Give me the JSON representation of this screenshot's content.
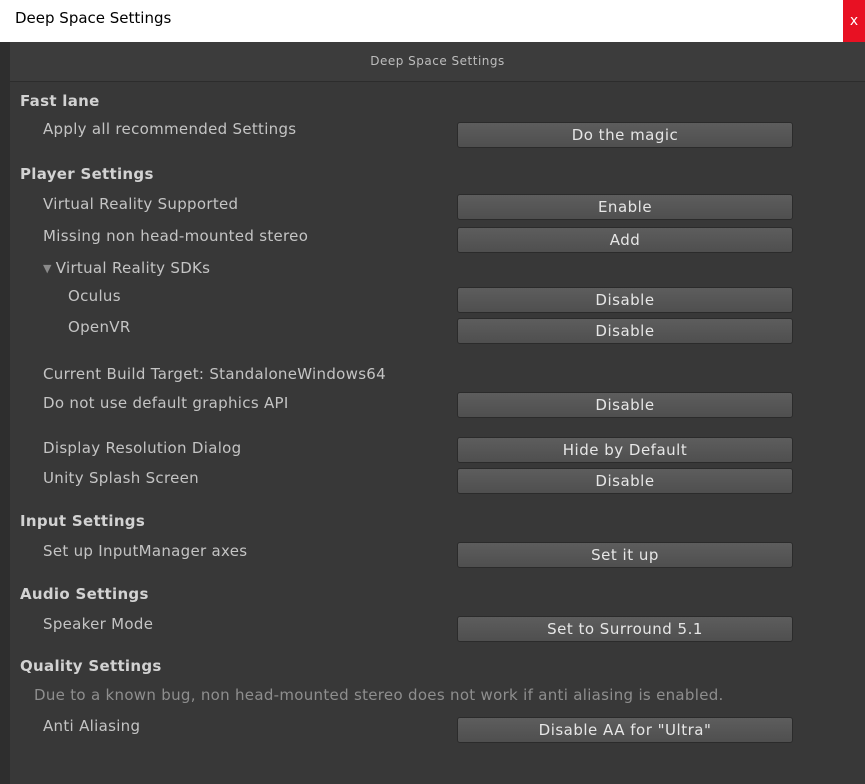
{
  "window": {
    "title": "Deep Space Settings",
    "close_glyph": "x"
  },
  "header": {
    "label": "Deep Space Settings"
  },
  "fast_lane": {
    "heading": "Fast lane",
    "apply_label": "Apply all recommended Settings",
    "apply_button": "Do the magic"
  },
  "player_settings": {
    "heading": "Player Settings",
    "vr_supported_label": "Virtual Reality Supported",
    "vr_supported_button": "Enable",
    "missing_stereo_label": "Missing non head-mounted stereo",
    "missing_stereo_button": "Add",
    "vr_sdks_label": "Virtual Reality SDKs",
    "oculus_label": "Oculus",
    "oculus_button": "Disable",
    "openvr_label": "OpenVR",
    "openvr_button": "Disable",
    "build_target_label": "Current Build Target: StandaloneWindows64",
    "graphics_api_label": "Do not use default graphics API",
    "graphics_api_button": "Disable",
    "resolution_dialog_label": "Display Resolution Dialog",
    "resolution_dialog_button": "Hide by Default",
    "splash_label": "Unity Splash Screen",
    "splash_button": "Disable"
  },
  "input_settings": {
    "heading": "Input Settings",
    "axes_label": "Set up InputManager axes",
    "axes_button": "Set it up"
  },
  "audio_settings": {
    "heading": "Audio Settings",
    "speaker_label": "Speaker Mode",
    "speaker_button": "Set to Surround 5.1"
  },
  "quality_settings": {
    "heading": "Quality Settings",
    "note": "Due to a known bug, non head-mounted stereo does not work if anti aliasing is enabled.",
    "aa_label": "Anti Aliasing",
    "aa_button": "Disable AA for \"Ultra\""
  },
  "colors": {
    "background": "#383838",
    "button": "#585858",
    "close": "#e81123"
  }
}
